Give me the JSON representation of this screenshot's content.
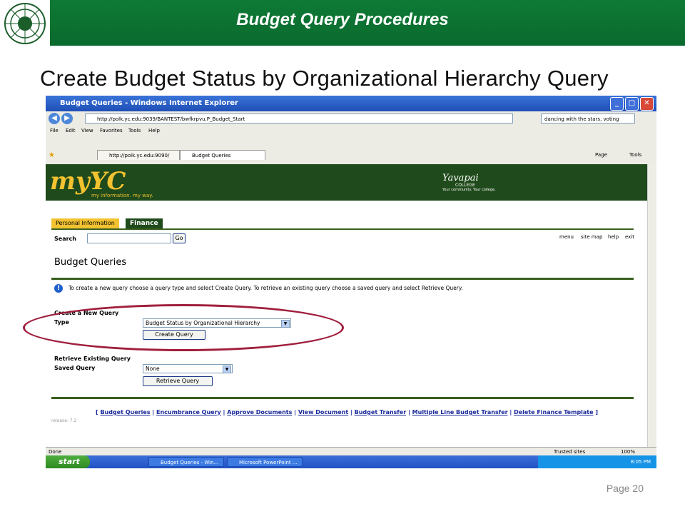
{
  "slide": {
    "banner_title": "Budget Query Procedures",
    "title": "Create Budget Status by Organizational Hierarchy Query",
    "page_number": "Page 20",
    "seal_text": "Yavapai College"
  },
  "browser": {
    "window_title": "Budget Queries - Windows Internet Explorer",
    "address": "http://polk.yc.edu:9039/BANTEST/bwfkrpvu.P_Budget_Start",
    "search_value": "dancing with the stars, voting",
    "menu": [
      "File",
      "Edit",
      "View",
      "Favorites",
      "Tools",
      "Help"
    ],
    "tabs": [
      {
        "label": "http://polk.yc.edu:9090/"
      },
      {
        "label": "Budget Queries"
      }
    ],
    "command_page": "Page",
    "command_tools": "Tools",
    "status_text": "Done",
    "zone": "Trusted sites",
    "zoom": "100%"
  },
  "myyc": {
    "logo": "myYC",
    "tagline": "my information. my way.",
    "college_name": "Yavapai",
    "college_sub": "COLLEGE",
    "college_tag": "Your community. Your college."
  },
  "tabs": [
    {
      "label": "Personal Information"
    },
    {
      "label": "Finance"
    }
  ],
  "toplinks": [
    "menu",
    "site map",
    "help",
    "exit"
  ],
  "search_label": "Search",
  "go_label": "Go",
  "page_heading": "Budget Queries",
  "info_text": "To create a new query choose a query type and select Create Query. To retrieve an existing query choose a saved query and select Retrieve Query.",
  "create": {
    "heading": "Create a New Query",
    "type_label": "Type",
    "type_value": "Budget Status by Organizational Hierarchy",
    "button": "Create Query"
  },
  "retrieve": {
    "heading": "Retrieve Existing Query",
    "saved_label": "Saved Query",
    "saved_value": "None",
    "button": "Retrieve Query"
  },
  "footer_links": [
    "Budget Queries",
    "Encumbrance Query",
    "Approve Documents",
    "View Document",
    "Budget Transfer",
    "Multiple Line Budget Transfer",
    "Delete Finance Template"
  ],
  "release": "release: 7.2",
  "taskbar": {
    "start": "start",
    "items": [
      "Budget Queries - Win...",
      "Microsoft PowerPoint ..."
    ],
    "clock": "8:05 PM"
  },
  "colors": {
    "banner_green": "#0e7a35",
    "myyc_green": "#1f4a1b",
    "finance_tab": "#1f4a1b",
    "personal_tab": "#f2c230",
    "highlight_ellipse": "#a01f3d"
  }
}
